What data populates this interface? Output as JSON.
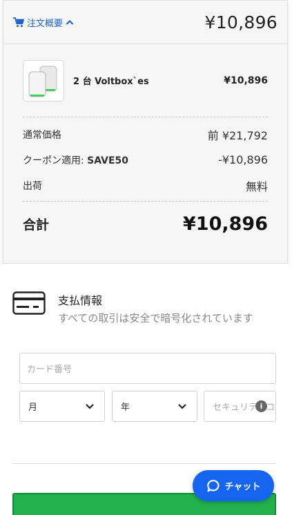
{
  "summary": {
    "toggle_label": "注文概要",
    "header_total": "¥10,896",
    "item": {
      "name": "2 台 Voltbox`es",
      "price": "¥10,896"
    },
    "rows": [
      {
        "label": "通常価格",
        "value": "前 ¥21,792"
      },
      {
        "label_prefix": "クーポン適用: ",
        "code": "SAVE50",
        "value": "-¥10,896"
      },
      {
        "label": "出荷",
        "value": "無料"
      }
    ],
    "total_label": "合計",
    "total_value": "¥10,896"
  },
  "payment": {
    "title": "支払情報",
    "subtitle": "すべての取引は安全で暗号化されています",
    "card_number_placeholder": "カード番号",
    "month_label": "月",
    "year_label": "年",
    "cvc_placeholder": "セキュリティコード"
  },
  "chat": {
    "label": "チャット"
  },
  "colors": {
    "accent": "#1f63c9",
    "chat": "#1565f0",
    "pay_button": "#22b14c"
  }
}
